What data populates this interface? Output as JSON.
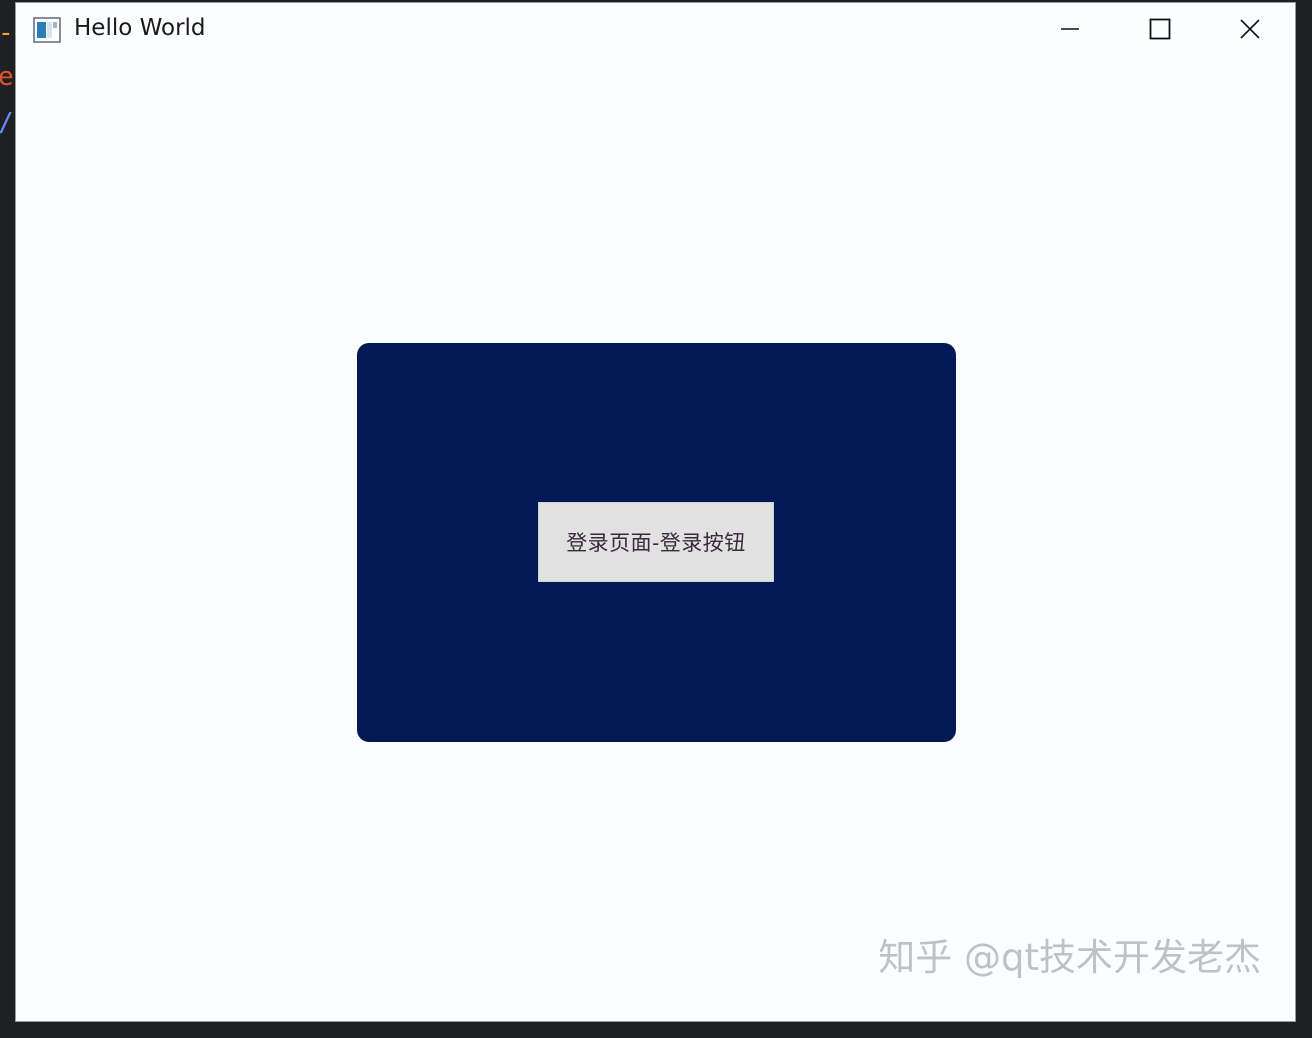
{
  "window": {
    "title": "Hello World",
    "controls": {
      "minimize": "minimize-icon",
      "maximize": "maximize-icon",
      "close": "close-icon"
    }
  },
  "background": {
    "glyph_1": "-",
    "glyph_2": "e",
    "glyph_3": "/",
    "glyph_colors": [
      "#f0a030",
      "#e0502a",
      "#6a8cff"
    ]
  },
  "main": {
    "panel_color": "#011a55",
    "login_button_label": "登录页面-登录按钮"
  },
  "watermark": "知乎 @qt技术开发老杰"
}
